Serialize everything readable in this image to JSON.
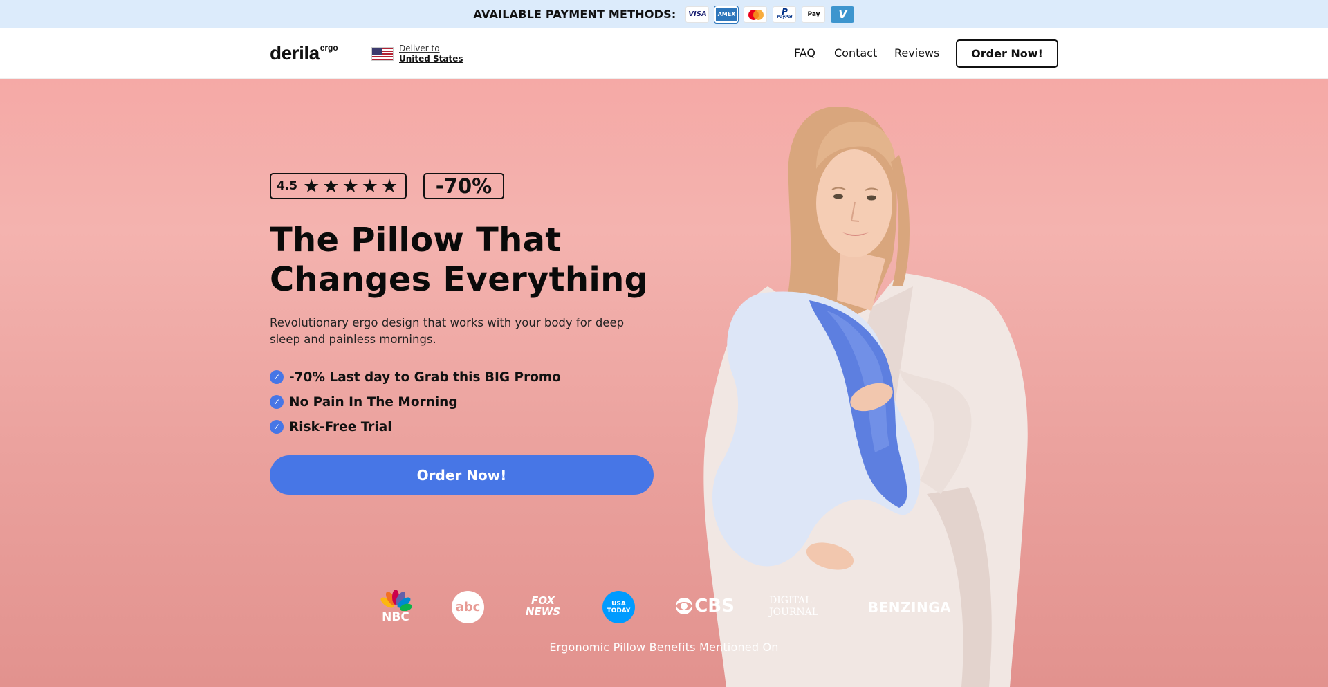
{
  "payment_bar": {
    "title": "AVAILABLE PAYMENT METHODS:",
    "methods": [
      {
        "name": "Visa",
        "text": "VISA"
      },
      {
        "name": "American Express",
        "text": "AMEX"
      },
      {
        "name": "Mastercard",
        "text": ""
      },
      {
        "name": "PayPal",
        "text": "PayPal"
      },
      {
        "name": "Apple Pay",
        "text": " Pay"
      },
      {
        "name": "Venmo",
        "text": "V"
      }
    ]
  },
  "header": {
    "logo_main": "derila",
    "logo_sup": "ergo",
    "deliver_label": "Deliver to",
    "deliver_country": "United States",
    "nav": {
      "faq": "FAQ",
      "contact": "Contact",
      "reviews": "Reviews"
    },
    "cta": "Order Now!"
  },
  "hero": {
    "rating_value": "4.5",
    "rating_stars": 5,
    "discount": "-70%",
    "headline_line1": "The Pillow That",
    "headline_line2": "Changes Everything",
    "subtext": "Revolutionary ergo design that works with your body for deep sleep and painless mornings.",
    "bullets": [
      "-70% Last day to Grab this BIG Promo",
      "No Pain In The Morning",
      "Risk-Free Trial"
    ],
    "cta": "Order Now!"
  },
  "press": {
    "logos": [
      "NBC",
      "abc",
      "FOX NEWS",
      "USA TODAY",
      "CBS",
      "DIGITAL JOURNAL",
      "BENZINGA"
    ],
    "caption": "Ergonomic Pillow Benefits Mentioned On"
  },
  "colors": {
    "accent": "#4776e6",
    "payment_bar_bg": "#dcebfb",
    "hero_bg": "#f4b3af"
  }
}
